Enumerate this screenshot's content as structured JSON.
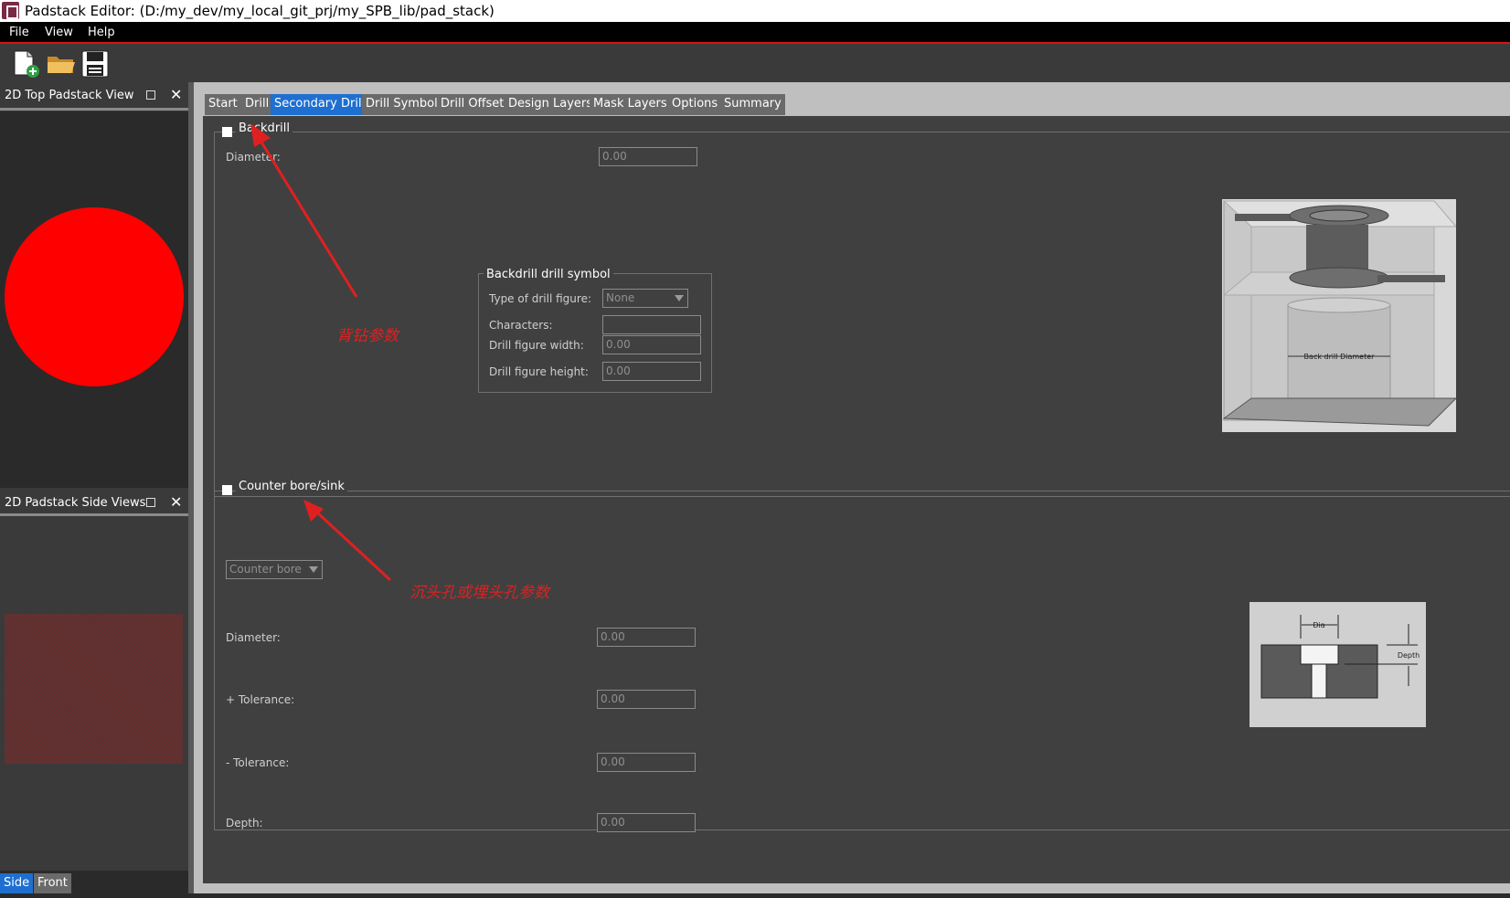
{
  "window": {
    "title": "Padstack Editor:  (D:/my_dev/my_local_git_prj/my_SPB_lib/pad_stack)"
  },
  "menu": [
    "File",
    "View",
    "Help"
  ],
  "toolbar": {
    "icons": [
      "new-file-icon",
      "open-folder-icon",
      "save-icon"
    ]
  },
  "docks": {
    "top_view": {
      "title": "2D Top Padstack View",
      "close": "✕"
    },
    "side_views": {
      "title": "2D Padstack Side Views",
      "close": "✕"
    },
    "view_tabs": [
      "Side",
      "Front"
    ]
  },
  "tabs": [
    "Start",
    "Drill",
    "Secondary Drill",
    "Drill Symbol",
    "Drill Offset",
    "Design Layers",
    "Mask Layers",
    "Options",
    "Summary"
  ],
  "active_tab": "Secondary Drill",
  "backdrill": {
    "checkbox_label": "Backdrill",
    "diameter_label": "Diameter:",
    "diameter_value": "0.00",
    "symbol_group": {
      "title": "Backdrill drill symbol",
      "type_label": "Type of drill figure:",
      "type_value": "None",
      "characters_label": "Characters:",
      "characters_value": "",
      "width_label": "Drill figure width:",
      "width_value": "0.00",
      "height_label": "Drill figure height:",
      "height_value": "0.00"
    },
    "figure_caption": "Back drill Diameter"
  },
  "counter": {
    "checkbox_label": "Counter bore/sink",
    "mode_value": "Counter bore",
    "diameter_label": "Diameter:",
    "diameter_value": "0.00",
    "plus_tol_label": "+ Tolerance:",
    "plus_tol_value": "0.00",
    "minus_tol_label": "- Tolerance:",
    "minus_tol_value": "0.00",
    "depth_label": "Depth:",
    "depth_value": "0.00",
    "figure_dia": "Dia",
    "figure_depth": "Depth"
  },
  "annotations": {
    "backdrill": "背钻参数",
    "counter": "沉头孔或埋头孔参数"
  },
  "colors": {
    "pad": "#ff0000",
    "accent": "#1e6fd0",
    "annotation": "#e02020"
  }
}
